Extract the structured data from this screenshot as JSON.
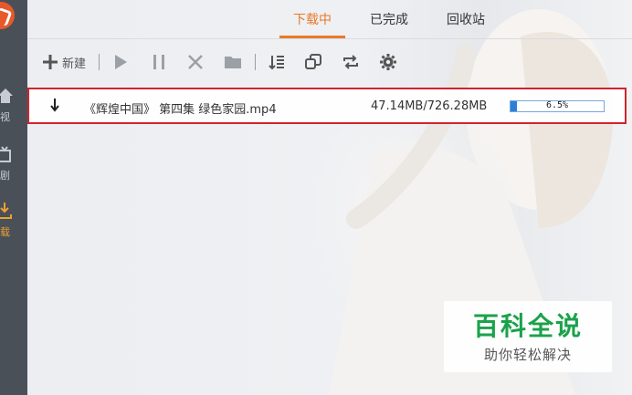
{
  "sidebar": {
    "items": [
      {
        "label": "视",
        "icon": "home-icon",
        "active": false
      },
      {
        "label": "剧",
        "icon": "tv-icon",
        "active": false
      },
      {
        "label": "载",
        "icon": "download-icon",
        "active": true
      }
    ]
  },
  "tabs": [
    {
      "label": "下载中",
      "active": true
    },
    {
      "label": "已完成",
      "active": false
    },
    {
      "label": "回收站",
      "active": false
    }
  ],
  "toolbar": {
    "new_label": "新建"
  },
  "download": {
    "filename": "《辉煌中国》 第四集 绿色家园.mp4",
    "size": "47.14MB/726.28MB",
    "progress_text": "6.5%",
    "progress_percent": 6.5
  },
  "watermark": {
    "title": "百科全说",
    "subtitle": "助你轻松解决"
  },
  "colors": {
    "accent": "#e8792a",
    "highlight_border": "#d0242e",
    "progress": "#2b7fd9",
    "watermark_green": "#1aa24a"
  }
}
